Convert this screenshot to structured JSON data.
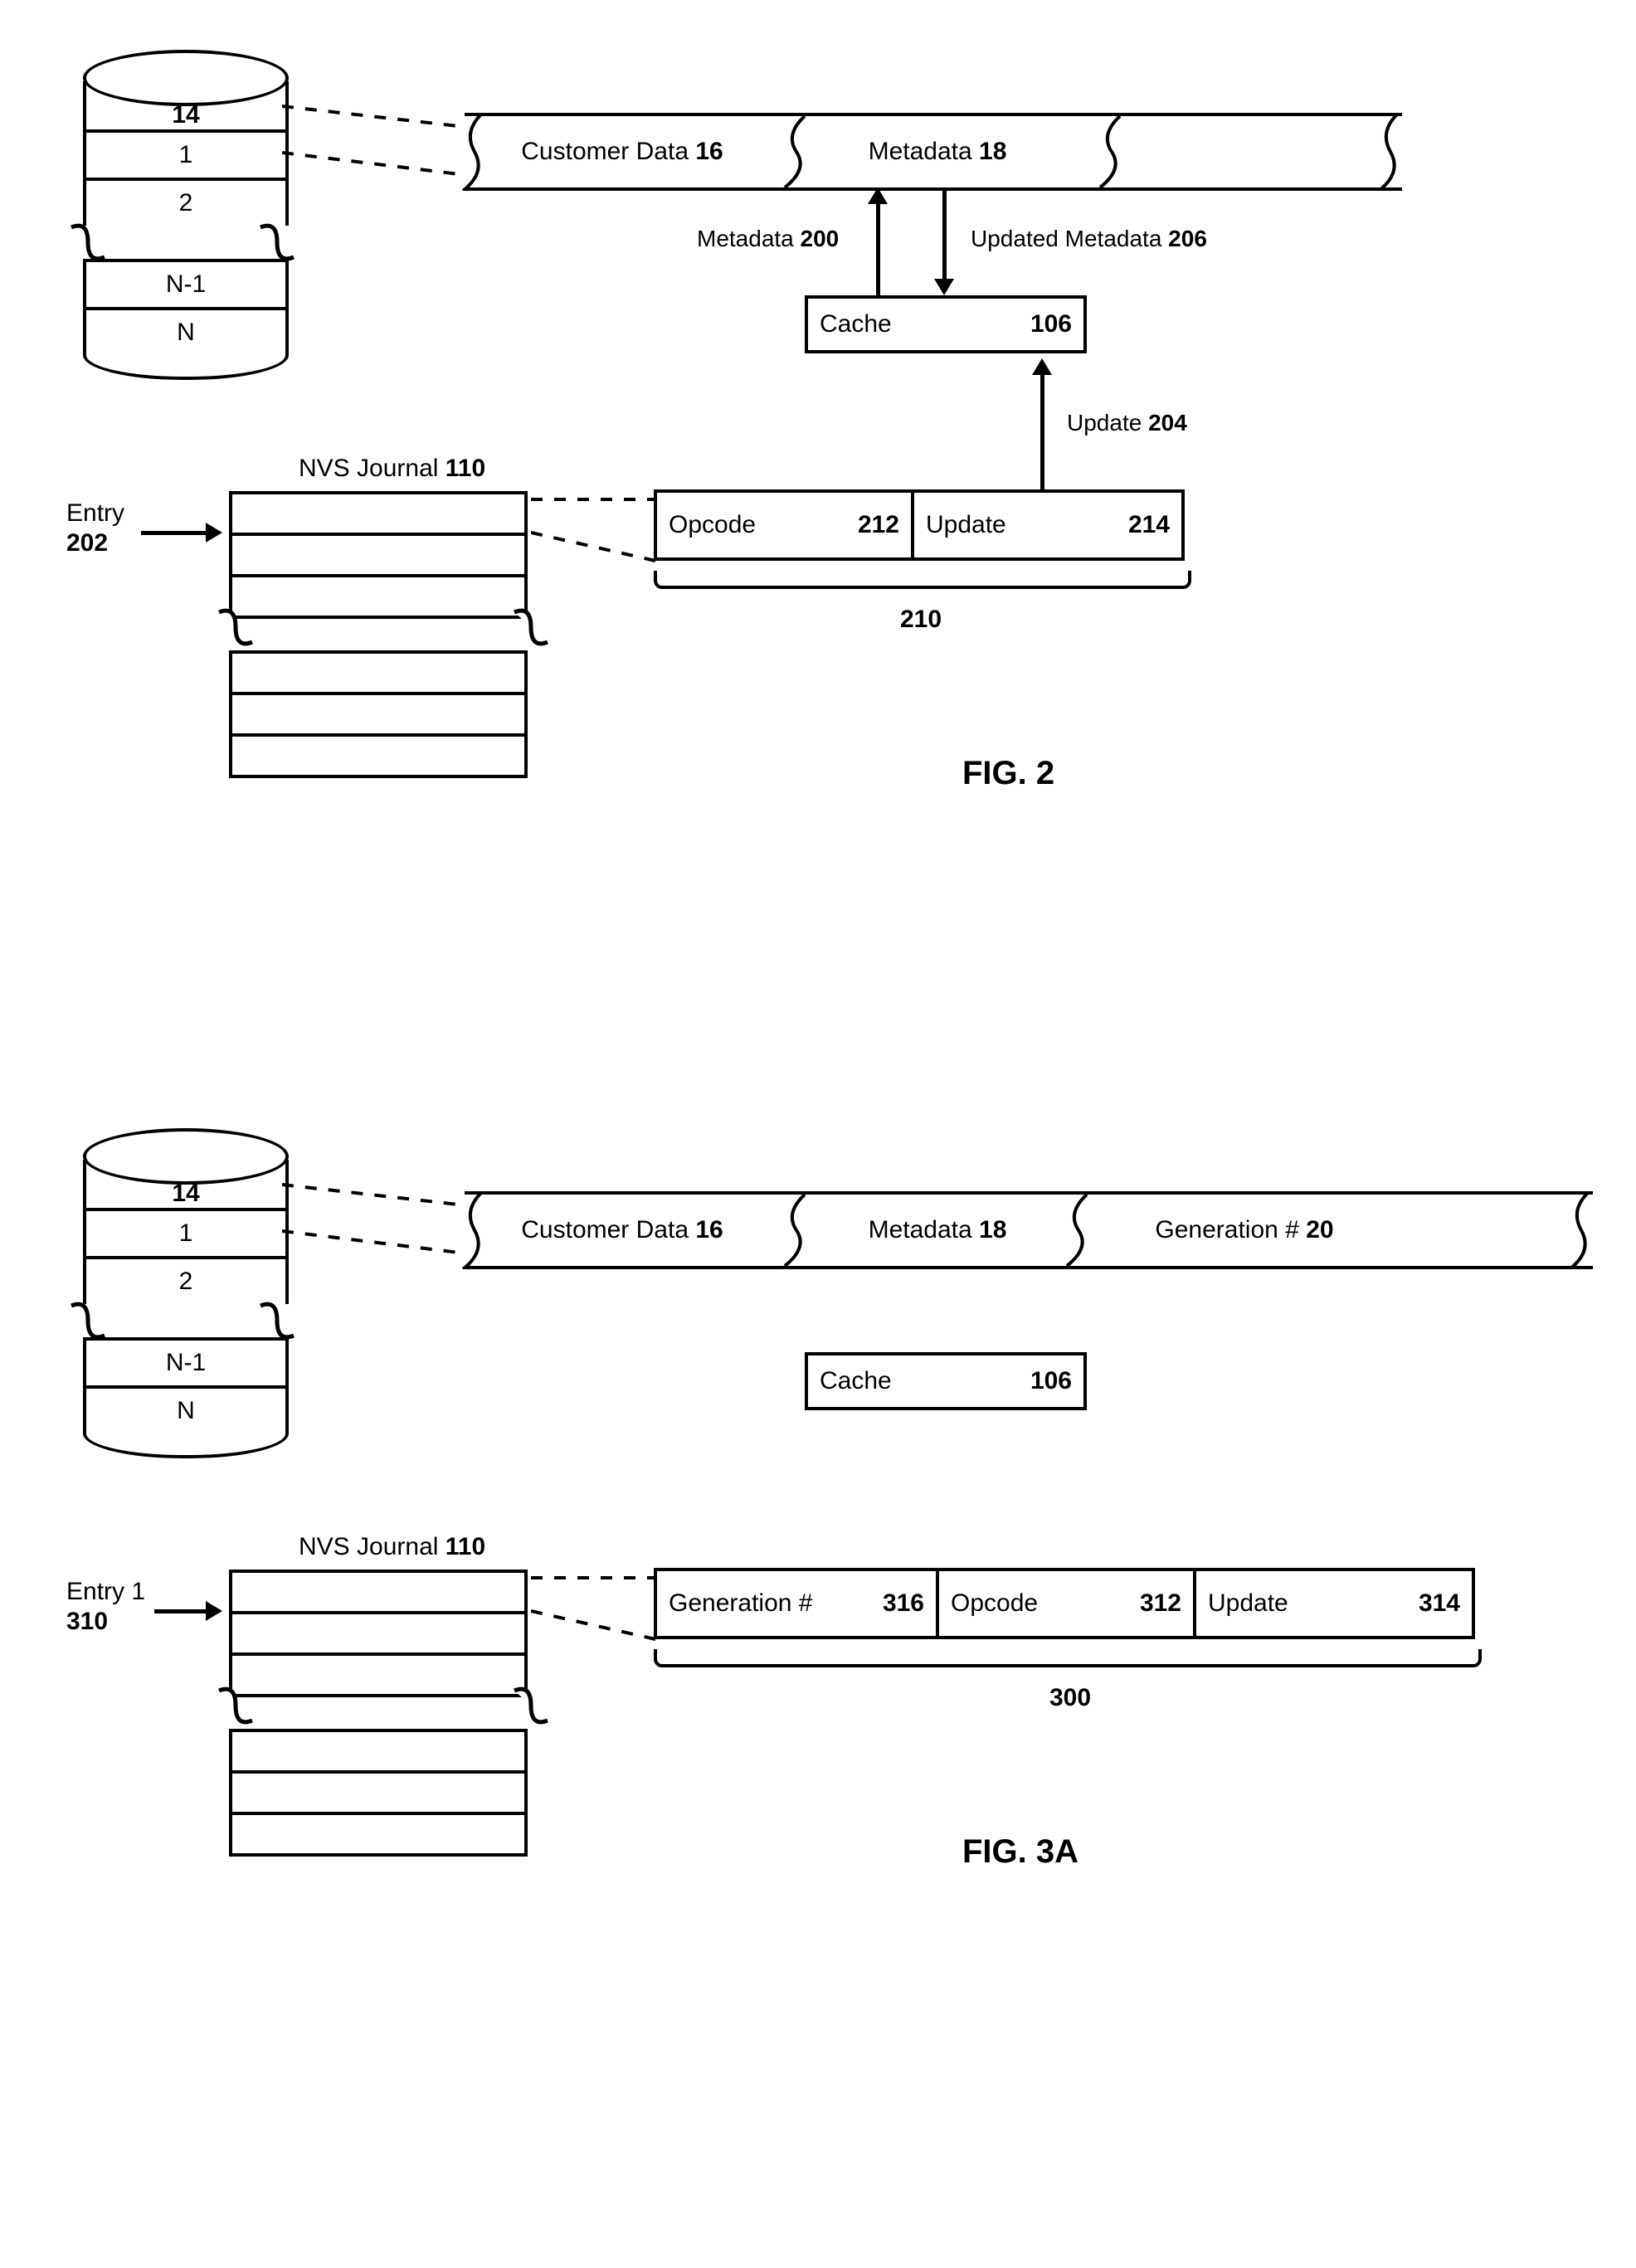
{
  "fig2": {
    "disk_id": "14",
    "disk_rows": [
      "1",
      "2",
      "N-1",
      "N"
    ],
    "banner": {
      "customer": "Customer Data",
      "customer_num": "16",
      "metadata": "Metadata",
      "metadata_num": "18"
    },
    "arrow_labels": {
      "metadata": "Metadata",
      "metadata_num": "200",
      "updated_metadata": "Updated Metadata",
      "updated_metadata_num": "206",
      "update": "Update",
      "update_num": "204"
    },
    "cache": {
      "label": "Cache",
      "num": "106"
    },
    "journal_title": "NVS Journal",
    "journal_title_num": "110",
    "entry_label": "Entry",
    "entry_label_num": "202",
    "entry": {
      "opcode": "Opcode",
      "opcode_num": "212",
      "update": "Update",
      "update_num": "214"
    },
    "entry_ref": "210",
    "fig_label": "FIG. 2"
  },
  "fig3a": {
    "disk_id": "14",
    "disk_rows": [
      "1",
      "2",
      "N-1",
      "N"
    ],
    "banner": {
      "customer": "Customer Data",
      "customer_num": "16",
      "metadata": "Metadata",
      "metadata_num": "18",
      "gen": "Generation #",
      "gen_num": "20"
    },
    "cache": {
      "label": "Cache",
      "num": "106"
    },
    "journal_title": "NVS Journal",
    "journal_title_num": "110",
    "entry_label": "Entry 1",
    "entry_label_num": "310",
    "entry": {
      "gen": "Generation #",
      "gen_num": "316",
      "opcode": "Opcode",
      "opcode_num": "312",
      "update": "Update",
      "update_num": "314"
    },
    "entry_ref": "300",
    "fig_label": "FIG. 3A"
  }
}
